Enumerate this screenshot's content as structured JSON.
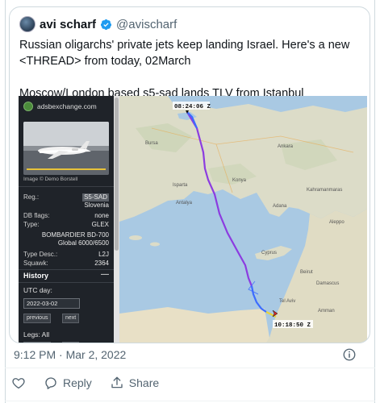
{
  "tweet": {
    "author_name": "avi scharf",
    "author_handle": "@avischarf",
    "text_line1": "Russian oligarchs' private jets keep landing Israel. Here's a new",
    "text_line2": "<THREAD> from today, 02March",
    "text_line3": "Moscow/London based s5-sad lands TLV from Istanbul",
    "timestamp": "9:12 PM · Mar 2, 2022"
  },
  "adsb": {
    "site": "adsbexchange.com",
    "photo_credit": "Image © Demo Borstell",
    "fields": [
      {
        "label": "Reg.:",
        "value": "S5-SAD"
      },
      {
        "label": "",
        "value": "Slovenia"
      },
      {
        "label": "DB flags:",
        "value": "none"
      },
      {
        "label": "Type:",
        "value": "GLEX"
      },
      {
        "label": "",
        "value": "BOMBARDIER BD-700"
      },
      {
        "label": "",
        "value": "Global 6000/6500"
      },
      {
        "label": "Type Desc.:",
        "value": "L2J"
      },
      {
        "label": "Squawk:",
        "value": "2364"
      }
    ],
    "history_title": "History",
    "history_toggle": "—",
    "utc_label": "UTC day:",
    "utc_date": "2022-03-02",
    "prev_label": "previous",
    "next_label": "next",
    "legs_label": "Legs: All"
  },
  "map": {
    "time_start": "08:24:06 Z",
    "time_end": "10:18:50 Z",
    "places": [
      "Bursa",
      "Ankara",
      "Isparta",
      "Antalya",
      "Konya",
      "Kahramanmaras",
      "Adana",
      "Aleppo",
      "Cyprus",
      "Beirut",
      "Damascus",
      "Amman",
      "Tel Aviv"
    ]
  },
  "actions": {
    "reply": "Reply",
    "share": "Share"
  },
  "colors": {
    "text": "#0f1419",
    "muted": "#536471",
    "verified": "#1d9bf0",
    "sea": "#a9c9e3",
    "land": "#d7d9c4",
    "track_purple": "#8c3ce0",
    "track_blue": "#3c6cff",
    "track_yellow": "#e8d43a"
  }
}
